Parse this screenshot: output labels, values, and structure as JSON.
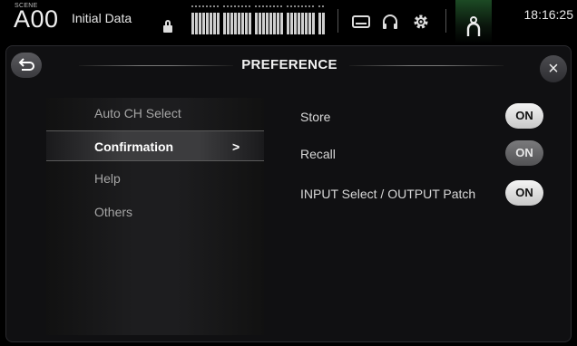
{
  "topbar": {
    "scene_label": "SCENE",
    "scene_number": "A00",
    "scene_name": "Initial Data",
    "time": "18:16:25",
    "icons": [
      "lock-icon",
      "recorder-icon",
      "headphones-icon",
      "gear-icon",
      "user-icon"
    ]
  },
  "panel": {
    "title": "PREFERENCE",
    "back_icon": "back-arrow-icon",
    "close_label": "×"
  },
  "menu": {
    "items": [
      {
        "label": "Auto CH Select",
        "selected": false
      },
      {
        "label": "Confirmation",
        "selected": true,
        "chevron": ">"
      },
      {
        "label": "Help",
        "selected": false
      },
      {
        "label": "Others",
        "selected": false
      }
    ]
  },
  "settings": [
    {
      "label": "Store",
      "toggle": "ON"
    },
    {
      "label": "Recall",
      "toggle": "ON"
    },
    {
      "label": "INPUT Select / OUTPUT Patch",
      "toggle": "ON"
    }
  ],
  "colors": {
    "accent_green": "#1c4a24",
    "toggle_on": "#e0e0e0",
    "toggle_dim": "#6a6a6c"
  }
}
